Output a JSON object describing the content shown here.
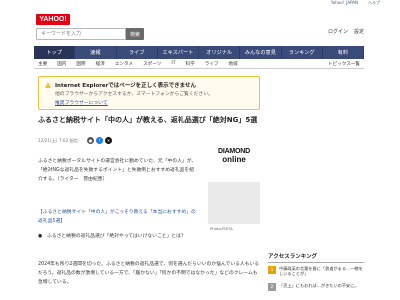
{
  "utility": {
    "links": [
      "Yahoo!",
      "JAPAN"
    ],
    "help": "ヘルプ"
  },
  "header": {
    "logo": "YAHOO!",
    "search_placeholder": "キーワードを入力",
    "search_button": "検索",
    "right_links": [
      "ログイン",
      "設定"
    ]
  },
  "nav": {
    "items": [
      "トップ",
      "速報",
      "ライブ",
      "エキスパート",
      "オリジナル",
      "みんなの意見",
      "ランキング",
      "有料"
    ]
  },
  "subnav": {
    "items": [
      "主要",
      "国内",
      "国際",
      "経済",
      "エンタメ",
      "スポーツ",
      "IT",
      "科学",
      "ライフ",
      "地域"
    ],
    "more": "トピックス一覧"
  },
  "notice": {
    "title": "Internet Explorerではページを正しく表示できません",
    "message": "他のブラウザーからアクセスするか、スマートフォンからご覧ください。",
    "link": "推奨ブラウザーについて"
  },
  "article": {
    "title": "ふるさと納税サイト「中の人」が教える、返礼品選び「絶対NG」5選",
    "meta": "12/21(土) 7:02 配信",
    "brand_line1": "DIAMOND",
    "brand_line2": "online",
    "photo_caption": "Photo:PIXTA",
    "lead": "ふるさと納税ポータルサイトの運営会社に勤めていた、元「中の人」が、「絶対NGな返礼品を失敗するポイント」と失敗例とおすすめ返礼品を紹介する。（ライター　菅由紀恵）",
    "link": "【ふるさと納税サイト「中の人」がこっそり教える「本当におすすめ」の返礼品5選】",
    "toc": "●　ふるさと納税の返礼品選び「絶対やってはいけないこと」とは？",
    "body": "2024年も残り2週間を切った。ふるさと納税の返礼品選で、何を選んだらいいのか悩んでいる人もいるだろう。返礼品の数が激増している一方で、「届かない」「何かの不明ではなかった」などのクレームも急増している。"
  },
  "ranking": {
    "title": "アクセスランキング",
    "items": [
      {
        "rank": "1",
        "text": "中藤政英の言葉を盾に「鉄道がまる…一緒をしいることが」"
      },
      {
        "rank": "2",
        "text": "「売上」にもおれぼ…がきたいの不安に。"
      }
    ]
  },
  "colors": {
    "nav_bg": "#3a4b7a",
    "logo_red": "#e60012",
    "notice_border": "#f0c040",
    "link": "#2a4fa0"
  }
}
